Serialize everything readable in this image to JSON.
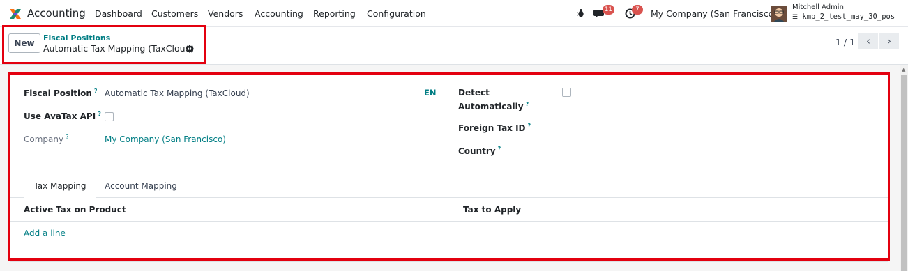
{
  "navbar": {
    "app_name": "Accounting",
    "menu": [
      "Dashboard",
      "Customers",
      "Vendors",
      "Accounting",
      "Reporting",
      "Configuration"
    ],
    "chat_count": "11",
    "activity_count": "7",
    "company": "My Company (San Francisco)",
    "user_name": "Mitchell Admin",
    "database": "kmp_2_test_may_30_pos"
  },
  "control_panel": {
    "new_label": "New",
    "breadcrumb": "Fiscal Positions",
    "title": "Automatic Tax Mapping (TaxCloud)",
    "pager_value": "1 / 1",
    "prev": "‹",
    "next": "›"
  },
  "form": {
    "fiscal_position_label": "Fiscal Position",
    "fiscal_position_value": "Automatic Tax Mapping (TaxCloud)",
    "lang": "EN",
    "use_avatax_label": "Use AvaTax API",
    "use_avatax_checked": false,
    "company_label": "Company",
    "company_value": "My Company (San Francisco)",
    "detect_label_1": "Detect",
    "detect_label_2": "Automatically",
    "detect_checked": false,
    "foreign_tax_id_label": "Foreign Tax ID",
    "country_label": "Country",
    "help_mark": "?"
  },
  "notebook": {
    "tabs": [
      "Tax Mapping",
      "Account Mapping"
    ],
    "active_tab": "Tax Mapping",
    "columns": [
      "Active",
      "Tax on Product",
      "Tax to Apply"
    ],
    "add_line": "Add a line"
  },
  "colors": {
    "accent": "#017e84",
    "highlight": "#e3000f",
    "badge": "#d9534f"
  }
}
